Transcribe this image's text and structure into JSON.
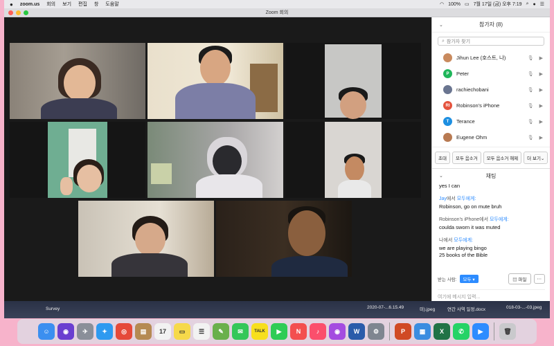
{
  "menubar": {
    "app_name": "zoom.us",
    "menus": [
      "회의",
      "보기",
      "편집",
      "창",
      "도움말"
    ],
    "battery": "100%",
    "clock": "7월 17일 (금) 오후 7:19"
  },
  "window": {
    "title": "Zoom 회의"
  },
  "participants_panel": {
    "title": "참가자 (8)",
    "search_placeholder": "참가자 찾기",
    "participants": [
      {
        "name": "Jihun Lee (호스트, 나)",
        "initials": "",
        "color": "#c98a5e"
      },
      {
        "name": "Peter",
        "initials": "P",
        "color": "#1fb65a"
      },
      {
        "name": "rachiechobani",
        "initials": "",
        "color": "#6a7590"
      },
      {
        "name": "Robinson's iPhone",
        "initials": "RI",
        "color": "#e5533d"
      },
      {
        "name": "Terance",
        "initials": "T",
        "color": "#1d8fe1"
      },
      {
        "name": "Eugene Ohm",
        "initials": "",
        "color": "#b87a52"
      }
    ],
    "buttons": {
      "invite": "초대",
      "mute_all": "모두 음소거",
      "unmute_all": "모두 음소거 해제",
      "more": "더 보기"
    }
  },
  "chat_panel": {
    "title": "채팅",
    "messages": [
      {
        "from_prefix": "",
        "from_name": "",
        "from_suffix": "",
        "to": "",
        "text": "yes I can"
      },
      {
        "from_prefix": "",
        "from_name": "Jay",
        "from_suffix": "에서 ",
        "to": "모두에게:",
        "text": "Robinson, go on mute bruh"
      },
      {
        "from_prefix": "Robinson's iPhone",
        "from_name": "",
        "from_suffix": "에서 ",
        "to": "모두에게:",
        "text": "coulda sworn it was muted"
      },
      {
        "from_prefix": "나에서 ",
        "from_name": "",
        "from_suffix": "",
        "to": "모두에게:",
        "text": "we are playing bingo\n25 books of the Bible"
      }
    ],
    "to_label": "받는 사람:",
    "to_value": "모두",
    "file_button": "파일",
    "input_placeholder": "여기에 메시지 입력..."
  },
  "desktop": {
    "files": [
      "Survey",
      "2020-07-...6.15.49",
      "미).jpeg",
      "연간 사역 일정.docx",
      "018-03-...-03.jpeg"
    ]
  },
  "dock": {
    "apps": [
      {
        "name": "finder-icon",
        "glyph": "☺",
        "color": "#3b8ff0"
      },
      {
        "name": "siri-icon",
        "glyph": "◉",
        "color": "#6a3fd0"
      },
      {
        "name": "launchpad-icon",
        "glyph": "✈",
        "color": "#8a8f99"
      },
      {
        "name": "safari-icon",
        "glyph": "✦",
        "color": "#2e9af0"
      },
      {
        "name": "chrome-icon",
        "glyph": "◎",
        "color": "#e54a3a"
      },
      {
        "name": "notes-book-icon",
        "glyph": "▤",
        "color": "#b58a52"
      },
      {
        "name": "calendar-icon",
        "glyph": "17",
        "color": "#f2f2f2"
      },
      {
        "name": "stickies-icon",
        "glyph": "▭",
        "color": "#f6d94a"
      },
      {
        "name": "reminders-icon",
        "glyph": "☰",
        "color": "#f2f2f2"
      },
      {
        "name": "photos-edit-icon",
        "glyph": "✎",
        "color": "#6ab04c"
      },
      {
        "name": "messages-icon",
        "glyph": "✉",
        "color": "#34c759"
      },
      {
        "name": "kakaotalk-icon",
        "glyph": "TALK",
        "color": "#f7df1e"
      },
      {
        "name": "facetime-icon",
        "glyph": "▶",
        "color": "#2ecc55"
      },
      {
        "name": "news-icon",
        "glyph": "N",
        "color": "#f34f4f"
      },
      {
        "name": "music-icon",
        "glyph": "♪",
        "color": "#fb4f6c"
      },
      {
        "name": "podcasts-icon",
        "glyph": "◉",
        "color": "#a44ce0"
      },
      {
        "name": "word-icon",
        "glyph": "W",
        "color": "#2a5caa"
      },
      {
        "name": "system-preferences-icon",
        "glyph": "⚙",
        "color": "#7f8690"
      },
      {
        "name": "powerpoint-icon",
        "glyph": "P",
        "color": "#d04a24"
      },
      {
        "name": "keynote-icon",
        "glyph": "▦",
        "color": "#3a8de0"
      },
      {
        "name": "excel-icon",
        "glyph": "X",
        "color": "#217346"
      },
      {
        "name": "whatsapp-icon",
        "glyph": "✆",
        "color": "#25d366"
      },
      {
        "name": "zoom-icon",
        "glyph": "▶",
        "color": "#2d8cff"
      },
      {
        "name": "trash-icon",
        "glyph": "🗑",
        "color": "#c9c9cc"
      }
    ]
  }
}
